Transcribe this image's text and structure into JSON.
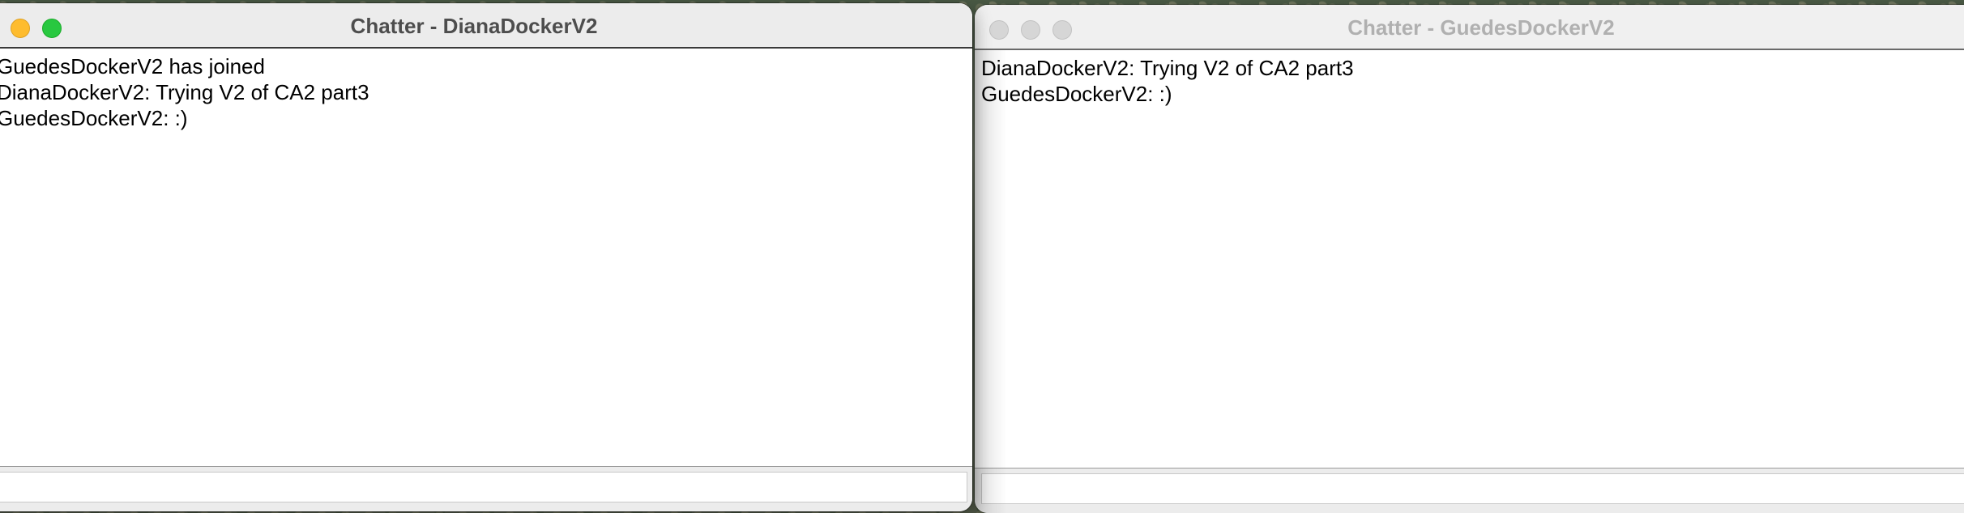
{
  "windows": [
    {
      "title": "Chatter - DianaDockerV2",
      "state": "active",
      "messages": [
        "GuedesDockerV2 has joined",
        "DianaDockerV2: Trying V2 of CA2 part3",
        "GuedesDockerV2: :)"
      ],
      "input_value": ""
    },
    {
      "title": "Chatter - GuedesDockerV2",
      "state": "inactive",
      "messages": [
        "DianaDockerV2: Trying V2 of CA2 part3",
        "GuedesDockerV2: :)"
      ],
      "input_value": ""
    }
  ],
  "colors": {
    "close": "#fe5f57",
    "minimize": "#febc2e",
    "maximize": "#28c840",
    "inactive_button": "#d6d6d6"
  }
}
